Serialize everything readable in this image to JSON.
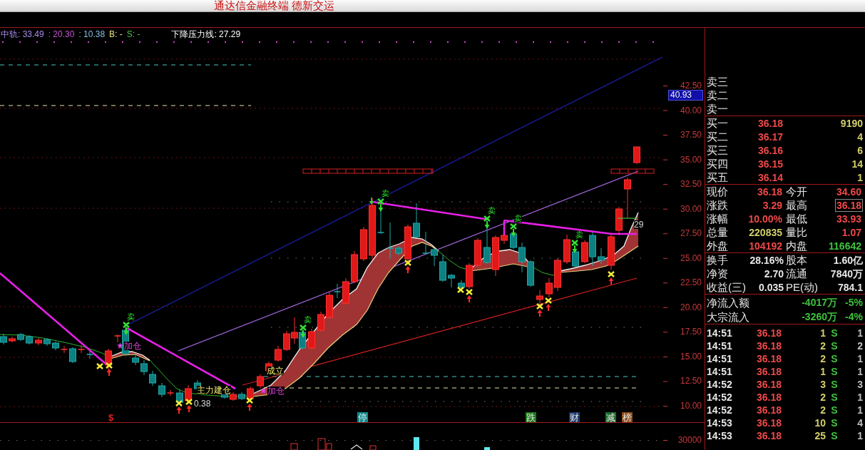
{
  "window": {
    "title": "通达信金融终端 德新交运"
  },
  "legend": [
    {
      "text": "中轨: 33.49",
      "color": "#a58ae6"
    },
    {
      "text": ": 20.30",
      "color": "#c855d2"
    },
    {
      "text": ": 10.38",
      "color": "#86bfe0"
    },
    {
      "text": "B: -",
      "color": "#f0e27a"
    },
    {
      "text": "S: -",
      "color": "#4fc24f"
    },
    {
      "text": "下降压力线: 27.29",
      "color": "#ffffff"
    }
  ],
  "price_chart": {
    "axis_labels": [
      "42.50",
      "40.00",
      "37.50",
      "35.00",
      "32.50",
      "30.00",
      "27.50",
      "25.00",
      "22.50",
      "20.00",
      "17.50",
      "15.00",
      "12.50",
      "10.00"
    ],
    "cursor_price": "40.93",
    "annotations": [
      {
        "kind": "add",
        "text": "加仓"
      },
      {
        "kind": "sell",
        "text": "卖"
      },
      {
        "kind": "note",
        "text": "主力建仓"
      },
      {
        "kind": "value",
        "text": "0.38"
      },
      {
        "kind": "add",
        "text": "加仓"
      },
      {
        "kind": "note",
        "text": "成立"
      },
      {
        "kind": "sell",
        "text": "卖"
      },
      {
        "kind": "sell",
        "text": "卖"
      },
      {
        "kind": "sell",
        "text": "卖"
      },
      {
        "kind": "sell",
        "text": "卖"
      },
      {
        "kind": "sell",
        "text": "卖"
      },
      {
        "kind": "value",
        "text": "29"
      }
    ],
    "event_tags": [
      {
        "kind": "glyph",
        "text": "$",
        "color": "#e02020"
      },
      {
        "kind": "tile",
        "text": "停",
        "color": "#128a8a"
      },
      {
        "kind": "tile",
        "text": "跌",
        "color": "#1b7a1b"
      },
      {
        "kind": "tile",
        "text": "财",
        "color": "#1a3a6a"
      },
      {
        "kind": "tile",
        "text": "减",
        "color": "#1b6a2b"
      },
      {
        "kind": "tile",
        "text": "榜",
        "color": "#8a4a18"
      }
    ]
  },
  "volume_chart": {
    "axis_labels": [
      "30000"
    ]
  },
  "order_book": {
    "asks": [
      {
        "label": "卖三"
      },
      {
        "label": "卖二"
      },
      {
        "label": "卖一"
      }
    ],
    "bids": [
      {
        "label": "买一",
        "price": "36.18",
        "volume": "9190"
      },
      {
        "label": "买二",
        "price": "36.17",
        "volume": "4"
      },
      {
        "label": "买三",
        "price": "36.16",
        "volume": "6"
      },
      {
        "label": "买四",
        "price": "36.15",
        "volume": "14"
      },
      {
        "label": "买五",
        "price": "36.14",
        "volume": "1"
      }
    ]
  },
  "quote": [
    {
      "label": "现价",
      "value": "36.18",
      "color": "#f04848",
      "highlighted": false
    },
    {
      "label": "今开",
      "value": "34.60",
      "color": "#f04848",
      "highlighted": false
    },
    {
      "label": "涨跌",
      "value": "3.29",
      "color": "#f04848",
      "highlighted": false
    },
    {
      "label": "最高",
      "value": "36.18",
      "color": "#f04848",
      "highlighted": true
    },
    {
      "label": "涨幅",
      "value": "10.00%",
      "color": "#f04848",
      "highlighted": false
    },
    {
      "label": "最低",
      "value": "33.93",
      "color": "#f04848",
      "highlighted": false
    },
    {
      "label": "总量",
      "value": "220835",
      "color": "#d4cf6a",
      "highlighted": false
    },
    {
      "label": "量比",
      "value": "1.07",
      "color": "#f04848",
      "highlighted": false
    },
    {
      "label": "外盘",
      "value": "104192",
      "color": "#f04848",
      "highlighted": false
    },
    {
      "label": "内盘",
      "value": "116642",
      "color": "#3ec23e",
      "highlighted": false
    }
  ],
  "stats": [
    {
      "label": "换手",
      "value": "28.16%"
    },
    {
      "label": "股本",
      "value": "1.60亿"
    },
    {
      "label": "净资",
      "value": "2.70"
    },
    {
      "label": "流通",
      "value": "7840万"
    },
    {
      "label": "收益(三)",
      "value": "0.035"
    },
    {
      "label": "PE(动)",
      "value": "784.1"
    }
  ],
  "fund_flow": [
    {
      "label": "净流入额",
      "amount": "-4017万",
      "percent": "-5%"
    },
    {
      "label": "大宗流入",
      "amount": "-3260万",
      "percent": "-4%"
    }
  ],
  "ticks": [
    {
      "time": "14:51",
      "price": "36.18",
      "volume": "1",
      "side": "S",
      "column_5": "1"
    },
    {
      "time": "14:51",
      "price": "36.18",
      "volume": "2",
      "side": "S",
      "column_5": "2"
    },
    {
      "time": "14:51",
      "price": "36.18",
      "volume": "2",
      "side": "S",
      "column_5": "1"
    },
    {
      "time": "14:51",
      "price": "36.18",
      "volume": "1",
      "side": "S",
      "column_5": "1"
    },
    {
      "time": "14:52",
      "price": "36.18",
      "volume": "3",
      "side": "S",
      "column_5": "3"
    },
    {
      "time": "14:52",
      "price": "36.18",
      "volume": "2",
      "side": "S",
      "column_5": "1"
    },
    {
      "time": "14:52",
      "price": "36.18",
      "volume": "2",
      "side": "S",
      "column_5": "1"
    },
    {
      "time": "14:53",
      "price": "36.18",
      "volume": "10",
      "side": "S",
      "column_5": "4"
    },
    {
      "time": "14:53",
      "price": "36.18",
      "volume": "25",
      "side": "S",
      "column_5": "1"
    }
  ]
}
